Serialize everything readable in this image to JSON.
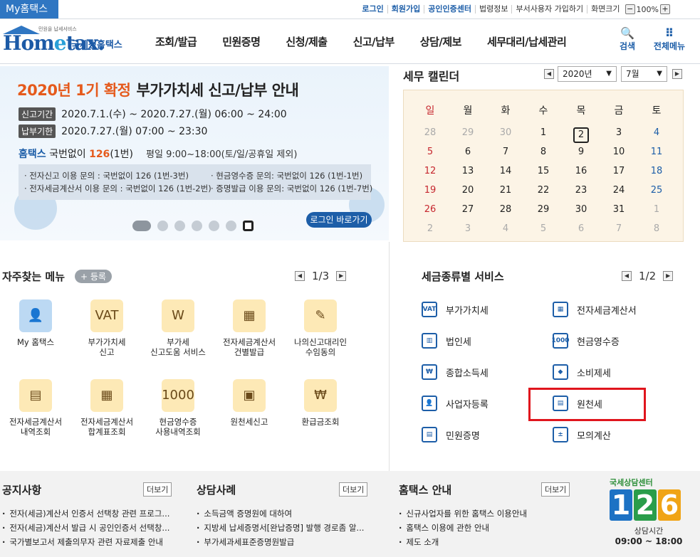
{
  "topbar": {
    "myhome_tab": "My홈택스",
    "links": [
      "로그인",
      "회원가입",
      "공인인증센터",
      "법령정보",
      "부서사용자 가입하기",
      "화면크기"
    ],
    "zoom_minus": "−",
    "zoom": "100%",
    "zoom_plus": "+"
  },
  "header": {
    "logo_small": "민원을 납세서비스",
    "logo_main": "Hom",
    "logo_e": "e",
    "logo_tax": "tax.",
    "logo_sub": "국세청홈택스",
    "nav": [
      "조회/발급",
      "민원증명",
      "신청/제출",
      "신고/납부",
      "상담/제보",
      "세무대리/납세관리"
    ],
    "search_label": "검색",
    "search_icon": "🔍",
    "allmenu_label": "전체메뉴",
    "allmenu_icon": "⠿"
  },
  "banner": {
    "title_red": "2020년 1기 확정",
    "title_rest": "부가가치세 신고/납부 안내",
    "row1_tag": "신고기간",
    "row1_text": "2020.7.1.(수) ~ 2020.7.27.(월) 06:00 ~ 24:00",
    "row2_tag": "납부기한",
    "row2_text": "2020.7.27.(월) 07:00 ~ 23:30",
    "phone_brand": "홈택스",
    "phone_text": "국번없이",
    "phone_num": "126",
    "phone_ext": "(1번)",
    "phone_hours": "평일 9:00~18:00(토/일/공휴일 제외)",
    "info_left": [
      "· 전자신고 이용 문의 : 국번없이 126 (1번-3번)",
      "· 전자세금계산서 이용 문의 : 국번없이 126 (1번-2번)"
    ],
    "info_right": [
      "· 현금영수증 문의: 국번없이 126 (1번-1번)",
      "· 증명발급 이용 문의: 국번없이 126 (1번-7번)"
    ],
    "login_btn": "로그인 바로가기",
    "slides": 6,
    "active_slide": 1
  },
  "calendar": {
    "title": "세무 캘린더",
    "year": "2020년",
    "month": "7월",
    "weekdays": [
      "일",
      "월",
      "화",
      "수",
      "목",
      "금",
      "토"
    ],
    "weeks": [
      [
        "28",
        "29",
        "30",
        "1",
        "2",
        "3",
        "4"
      ],
      [
        "5",
        "6",
        "7",
        "8",
        "9",
        "10",
        "11"
      ],
      [
        "12",
        "13",
        "14",
        "15",
        "16",
        "17",
        "18"
      ],
      [
        "19",
        "20",
        "21",
        "22",
        "23",
        "24",
        "25"
      ],
      [
        "26",
        "27",
        "28",
        "29",
        "30",
        "31",
        "1"
      ],
      [
        "2",
        "3",
        "4",
        "5",
        "6",
        "7",
        "8"
      ]
    ],
    "today": "2"
  },
  "favorites": {
    "title": "자주찾는 메뉴",
    "register": "+ 등록",
    "pager": "1/3",
    "items": [
      {
        "label": "My 홈택스",
        "icon": "👤"
      },
      {
        "label": "부가가치세\n신고",
        "icon": "VAT"
      },
      {
        "label": "부가세\n신고도움 서비스",
        "icon": "W"
      },
      {
        "label": "전자세금계산서\n건별발급",
        "icon": "▦"
      },
      {
        "label": "나의신고대리인\n수임동의",
        "icon": "✎"
      },
      {
        "label": "전자세금계산서\n내역조회",
        "icon": "▤"
      },
      {
        "label": "전자세금계산서\n합계표조회",
        "icon": "▦"
      },
      {
        "label": "현금영수증\n사용내역조회",
        "icon": "1000"
      },
      {
        "label": "원천세신고",
        "icon": "▣"
      },
      {
        "label": "환급금조회",
        "icon": "₩"
      }
    ]
  },
  "tax_services": {
    "title": "세금종류별 서비스",
    "pager": "1/2",
    "items": [
      {
        "label": "부가가치세",
        "icon": "VAT"
      },
      {
        "label": "전자세금계산서",
        "icon": "▦"
      },
      {
        "label": "법인세",
        "icon": "▥"
      },
      {
        "label": "현금영수증",
        "icon": "1000"
      },
      {
        "label": "종합소득세",
        "icon": "₩"
      },
      {
        "label": "소비제세",
        "icon": "◆"
      },
      {
        "label": "사업자등록",
        "icon": "👤"
      },
      {
        "label": "원천세",
        "icon": "▤"
      },
      {
        "label": "민원증명",
        "icon": "▤"
      },
      {
        "label": "모의계산",
        "icon": "±"
      }
    ]
  },
  "notice": {
    "title": "공지사항",
    "more": "더보기",
    "items": [
      "전자(세금)계산서 인증서 선택창 관련 프로그...",
      "전자(세금)계산서 발급 시 공인인증서 선택창...",
      "국가별보고서 제출의무자 관련 자료제출 안내"
    ]
  },
  "consult": {
    "title": "상담사례",
    "more": "더보기",
    "items": [
      "소득금액 증명원에 대하여",
      "지방세 납세증명서[완납증명] 발행 경로좀 알...",
      "부가세과세표준증명원발급"
    ]
  },
  "guide": {
    "title": "홈택스 안내",
    "more": "더보기",
    "items": [
      "신규사업자를 위한 홈택스 이용안내",
      "홈택스 이용에 관한 안내",
      "제도 소개"
    ]
  },
  "center": {
    "brand": "국세상담센터",
    "d1": "1",
    "d2": "2",
    "d3": "6",
    "label": "상담시간",
    "time": "09:00 ~ 18:00"
  },
  "colors": {
    "accent": "#1d5ea8",
    "highlight": "#e0151d",
    "banner_red": "#e55a1c"
  }
}
